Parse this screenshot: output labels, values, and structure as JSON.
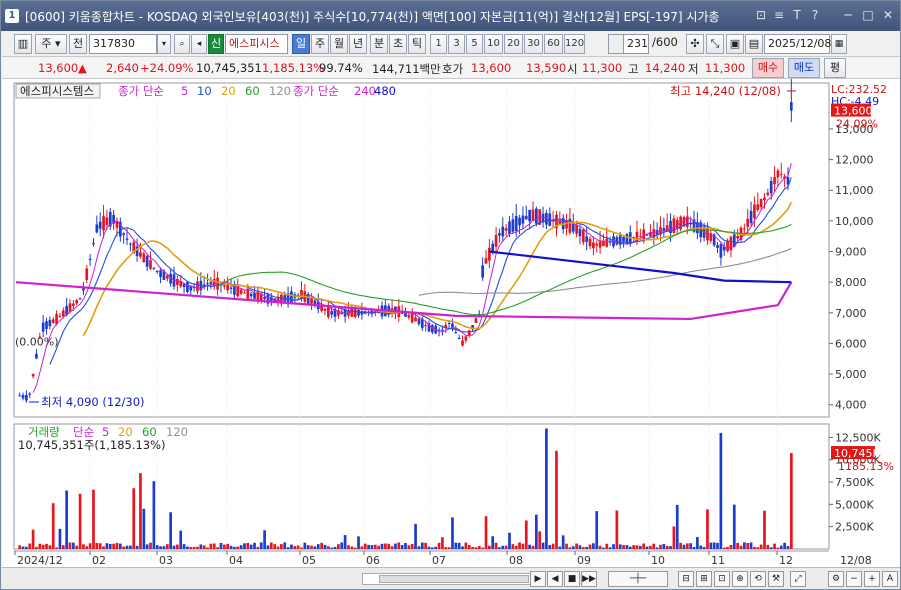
{
  "window": {
    "app_number": "1",
    "title": "[0600] 키움종합차트 - KOSDAQ 외국인보유[403(천)] 주식수[10,774(천)] 액면[100] 자본금[11(억)] 결산[12월] EPS[-197] 시가총",
    "title_buttons": [
      "⊡",
      "≡",
      "T",
      "?",
      "─",
      "□",
      "✕"
    ]
  },
  "toolbar": {
    "cycle_select": "주",
    "cycle_prev": "전",
    "stock_code": "317830",
    "stock_name": "에스피시스",
    "tag_new": "신",
    "period_tabs": [
      "일",
      "주",
      "월",
      "년",
      "분",
      "초",
      "틱"
    ],
    "period_selected": "일",
    "interval_buttons": [
      "1",
      "3",
      "5",
      "10",
      "20",
      "30",
      "60",
      "120"
    ],
    "count": "231",
    "count_total": "/600",
    "date": "2025/12/08"
  },
  "quote": {
    "price": "13,600",
    "arrow": "▲",
    "change": "2,640",
    "change_pct": "+24.09%",
    "volume": "10,745,351",
    "volume_ratio": "1,185.13%",
    "strength": "99.74%",
    "trade_value": "144,711백만",
    "label_hoga": "호가",
    "ask": "13,600",
    "bid": "13,590",
    "label_open": "시",
    "open": "11,300",
    "label_high": "고",
    "high": "14,240",
    "label_low": "저",
    "low": "11,300",
    "buy_button": "매수",
    "sell_button": "매도",
    "eval_button": "평"
  },
  "legend": {
    "stock_name": "에스피시스템스",
    "ma_label": "종가 단순",
    "ma_periods": [
      "5",
      "10",
      "20",
      "60",
      "120"
    ],
    "ma2_label": "종가 단순",
    "ma2_periods": [
      "240",
      "480"
    ],
    "volume_label": "거래량",
    "volume_ma_label": "단순",
    "volume_ma_periods": [
      "5",
      "20",
      "60",
      "120"
    ],
    "volume_value": "10,745,351주(1,185.13%)"
  },
  "annotations": {
    "high_label": "최고 14,240 (12/08)",
    "low_label": "최저 4,090 (12/30)",
    "low_pct": "(0.00%)",
    "lc": "LC:232.52",
    "hc": "HC:-4.49",
    "price_tag": "13,600",
    "pct_tag": "24.09%",
    "vol_tag": "10,745K",
    "vol_pct_tag": "1185.13%"
  },
  "colors": {
    "up": "#e8141e",
    "down": "#1a3cd0",
    "ma5": "#c81edc",
    "ma10": "#2050e0",
    "ma20": "#e0a010",
    "ma60": "#28a028",
    "ma120": "#909090",
    "ma240": "#d020d0",
    "ma480": "#1010d0"
  },
  "chart_data": [
    {
      "type": "candlestick",
      "y_ticks": [
        "4,000",
        "5,000",
        "6,000",
        "7,000",
        "8,000",
        "9,000",
        "10,000",
        "11,000",
        "12,000",
        "13,000"
      ],
      "x_ticks": [
        "2024/12",
        "02",
        "03",
        "04",
        "05",
        "06",
        "07",
        "08",
        "09",
        "10",
        "11",
        "12",
        "12/08"
      ],
      "ylim": [
        3600,
        14500
      ],
      "x": [
        "2024/12",
        "02",
        "03",
        "04",
        "05",
        "06",
        "07",
        "08",
        "09",
        "10",
        "11",
        "12"
      ],
      "close_approx": [
        4300,
        10600,
        8900,
        7000,
        7700,
        7400,
        6800,
        6400,
        10200,
        9800,
        10500,
        13600
      ]
    },
    {
      "type": "bar",
      "title": "거래량",
      "y_ticks": [
        "2,500K",
        "5,000K",
        "7,500K",
        "10,000K",
        "12,500K"
      ],
      "ylim": [
        0,
        14000
      ]
    }
  ]
}
